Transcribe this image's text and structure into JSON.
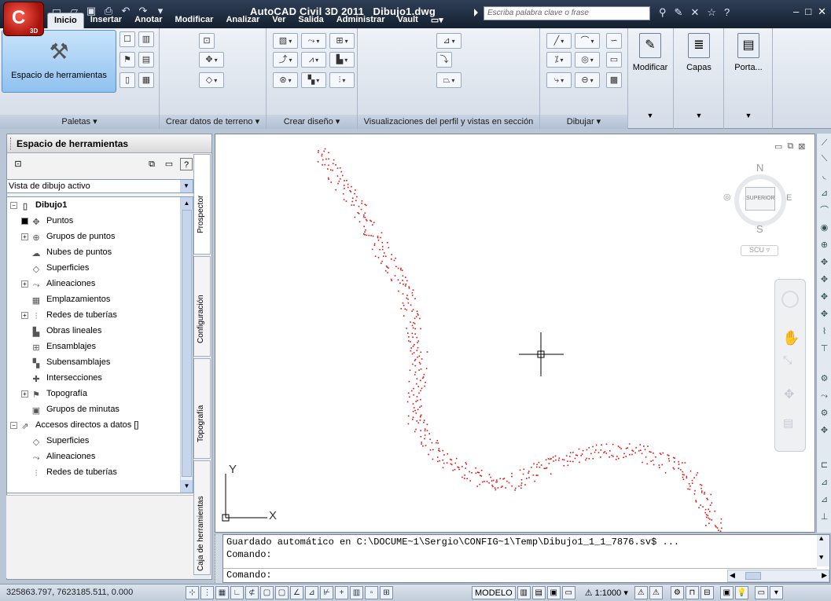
{
  "window": {
    "app_name": "AutoCAD Civil 3D 2011",
    "file_name": "Dibujo1.dwg",
    "app_badge": "3D",
    "search_placeholder": "Escriba palabra clave o frase"
  },
  "ribbon": {
    "tabs": [
      {
        "label": "Inicio",
        "active": true
      },
      {
        "label": "Insertar"
      },
      {
        "label": "Anotar"
      },
      {
        "label": "Modificar"
      },
      {
        "label": "Analizar"
      },
      {
        "label": "Ver"
      },
      {
        "label": "Salida"
      },
      {
        "label": "Administrar"
      },
      {
        "label": "Vault"
      }
    ],
    "big_button_label": "Espacio de herramientas",
    "panels": [
      {
        "title": "Paletas ▾"
      },
      {
        "title": "Crear datos de terreno ▾"
      },
      {
        "title": "Crear diseño ▾"
      },
      {
        "title": "Visualizaciones del perfil y vistas en sección"
      },
      {
        "title": "Dibujar ▾"
      }
    ],
    "tall_buttons": [
      {
        "label": "Modificar"
      },
      {
        "label": "Capas"
      },
      {
        "label": "Porta..."
      }
    ]
  },
  "toolspace": {
    "title": "Espacio de herramientas",
    "view_select": "Vista de dibujo activo",
    "tree": [
      {
        "label": "Dibujo1",
        "icon": "drawing-icon",
        "bold": true
      },
      {
        "label": "Puntos",
        "icon": "point-icon"
      },
      {
        "label": "Grupos de puntos",
        "icon": "point-group-icon"
      },
      {
        "label": "Nubes de puntos",
        "icon": "point-cloud-icon"
      },
      {
        "label": "Superficies",
        "icon": "surface-icon"
      },
      {
        "label": "Alineaciones",
        "icon": "alignment-icon"
      },
      {
        "label": "Emplazamientos",
        "icon": "site-icon"
      },
      {
        "label": "Redes de tuberías",
        "icon": "pipe-network-icon"
      },
      {
        "label": "Obras lineales",
        "icon": "corridor-icon"
      },
      {
        "label": "Ensamblajes",
        "icon": "assembly-icon"
      },
      {
        "label": "Subensamblajes",
        "icon": "subassembly-icon"
      },
      {
        "label": "Intersecciones",
        "icon": "intersection-icon"
      },
      {
        "label": "Topografía",
        "icon": "survey-icon"
      },
      {
        "label": "Grupos de minutas",
        "icon": "view-frame-icon"
      },
      {
        "label": "Accesos directos a datos []",
        "icon": "shortcut-icon"
      },
      {
        "label": "Superficies",
        "icon": "surface-shortcut-icon"
      },
      {
        "label": "Alineaciones",
        "icon": "alignment-shortcut-icon"
      },
      {
        "label": "Redes de tuberías",
        "icon": "pipe-shortcut-icon"
      }
    ],
    "vertical_tabs": [
      "Prospector",
      "Configuración",
      "Topografía",
      "Caja de herramientas"
    ]
  },
  "viewport": {
    "viewcube_face": "SUPERIOR",
    "compass": {
      "n": "N",
      "s": "S",
      "e": "E"
    },
    "ucs_label": "SCU",
    "axis_x": "X",
    "axis_y": "Y"
  },
  "command": {
    "history_line1": "Guardado automático en C:\\DOCUME~1\\Sergio\\CONFIG~1\\Temp\\Dibujo1_1_1_7876.sv$ ...",
    "history_line2": "Comando:",
    "prompt": "Comando:"
  },
  "status": {
    "coordinates": "325863.797, 7623185.511, 0.000",
    "model_label": "MODELO",
    "scale": "1:1000"
  },
  "colors": {
    "points": "#e01010",
    "title_bar": "#1c2a3d",
    "ribbon_bg": "#dfe6ef"
  }
}
